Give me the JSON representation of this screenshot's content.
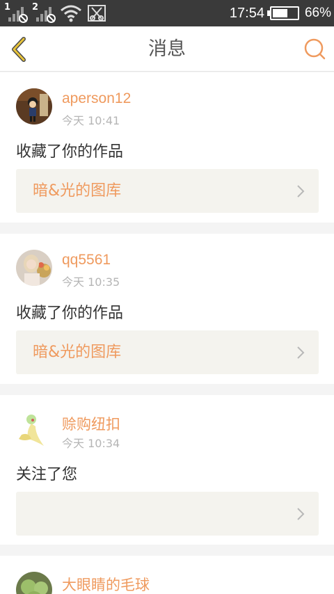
{
  "status_bar": {
    "sim1": "1",
    "sim2": "2",
    "time": "17:54",
    "battery_percent": "66%",
    "battery_level": 0.66
  },
  "header": {
    "title": "消息"
  },
  "notifications": [
    {
      "username": "aperson12",
      "time": "今天 10:41",
      "action": "收藏了你的作品",
      "link": "暗&光的图库"
    },
    {
      "username": "qq5561",
      "time": "今天 10:35",
      "action": "收藏了你的作品",
      "link": "暗&光的图库"
    },
    {
      "username": "赊购纽扣",
      "time": "今天 10:34",
      "action": "关注了您",
      "link": ""
    },
    {
      "username": "大眼睛的毛球",
      "time": "",
      "action": "",
      "link": ""
    }
  ],
  "colors": {
    "accent": "#ef9a5e",
    "status_bar_bg": "#3a3a3a",
    "link_box_bg": "#f4f3ee",
    "back_icon": "#e8c43a"
  }
}
